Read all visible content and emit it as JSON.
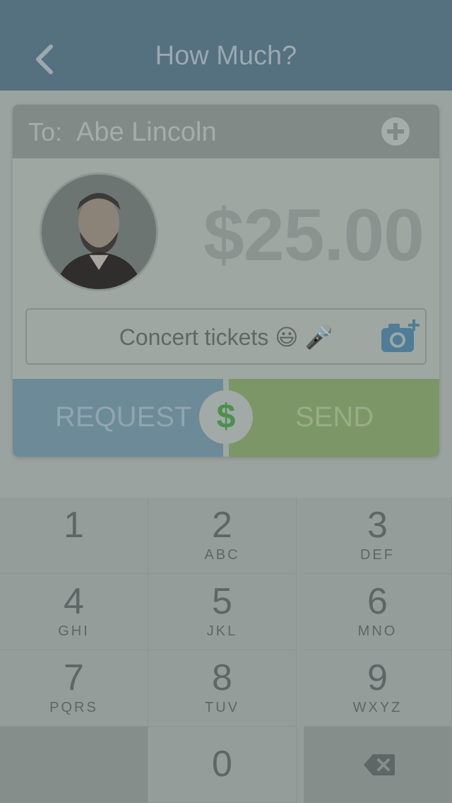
{
  "header": {
    "title": "How Much?"
  },
  "recipient": {
    "label": "To:",
    "name": "Abe Lincoln"
  },
  "amount": "$25.00",
  "note": {
    "text": "Concert tickets 😃 🎤"
  },
  "actions": {
    "request_label": "REQUEST",
    "currency_symbol": "$",
    "send_label": "SEND"
  },
  "keypad": {
    "keys": [
      {
        "digit": "1",
        "letters": ""
      },
      {
        "digit": "2",
        "letters": "ABC"
      },
      {
        "digit": "3",
        "letters": "DEF"
      },
      {
        "digit": "4",
        "letters": "GHI"
      },
      {
        "digit": "5",
        "letters": "JKL"
      },
      {
        "digit": "6",
        "letters": "MNO"
      },
      {
        "digit": "7",
        "letters": "PQRS"
      },
      {
        "digit": "8",
        "letters": "TUV"
      },
      {
        "digit": "9",
        "letters": "WXYZ"
      },
      {
        "digit": "0",
        "letters": ""
      }
    ]
  },
  "colors": {
    "header": "#55707f",
    "request": "#6d8a99",
    "send": "#7d9668",
    "dollar_icon": "#4e8e4e"
  }
}
